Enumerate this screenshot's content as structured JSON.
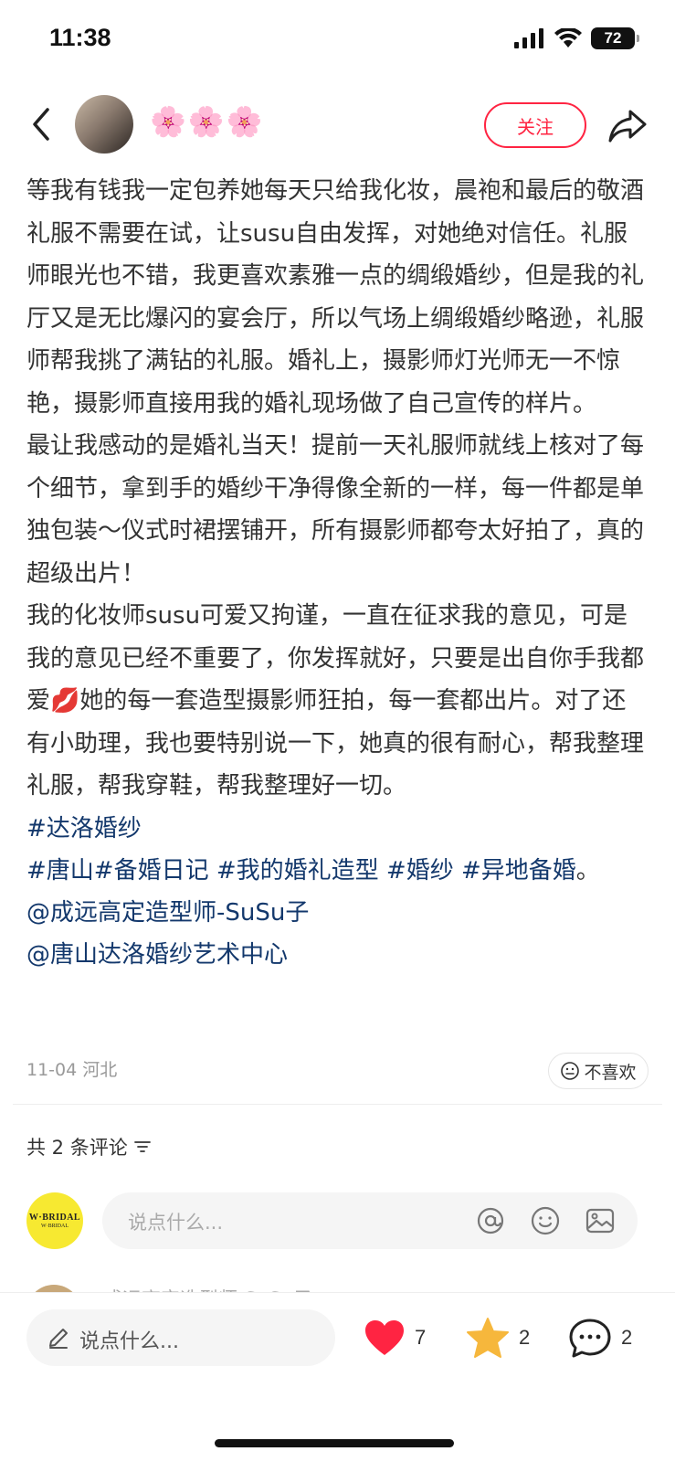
{
  "status_bar": {
    "time": "11:38",
    "battery": "72"
  },
  "nav": {
    "author_name": "🌸🌸🌸",
    "follow_label": "关注"
  },
  "post": {
    "paragraphs": [
      "等我有钱我一定包养她每天只给我化妆，晨袍和最后的敬酒礼服不需要在试，让susu自由发挥，对她绝对信任。礼服师眼光也不错，我更喜欢素雅一点的绸缎婚纱，但是我的礼厅又是无比爆闪的宴会厅，所以气场上绸缎婚纱略逊，礼服师帮我挑了满钻的礼服。婚礼上，摄影师灯光师无一不惊艳，摄影师直接用我的婚礼现场做了自己宣传的样片。",
      "最让我感动的是婚礼当天！提前一天礼服师就线上核对了每个细节，拿到手的婚纱干净得像全新的一样，每一件都是单独包装～仪式时裙摆铺开，所有摄影师都夸太好拍了，真的超级出片！",
      "我的化妆师susu可爱又拘谨，一直在征求我的意见，可是我的意见已经不重要了，你发挥就好，只要是出自你手我都爱💋她的每一套造型摄影师狂拍，每一套都出片。对了还有小助理，我也要特别说一下，她真的很有耐心，帮我整理礼服，帮我穿鞋，帮我整理好一切。"
    ],
    "tag_line1": [
      "#达洛婚纱"
    ],
    "tag_line2": [
      "#唐山",
      "#备婚日记",
      "#我的婚礼造型",
      "#婚纱",
      "#异地备婚"
    ],
    "tag_line2_suffix": "。",
    "mentions": [
      "@成远高定造型师-SuSu子",
      "@唐山达洛婚纱艺术中心"
    ],
    "date_location": "11-04 河北",
    "dislike_label": "不喜欢"
  },
  "comments": {
    "header": "共 2 条评论",
    "input_placeholder": "说点什么...",
    "my_avatar_text": "W·BRIDAL",
    "my_avatar_subtext": "W·BRIDAL",
    "partial_comment_name": "成远高定造型师-SuSu子"
  },
  "bottom_bar": {
    "input_placeholder": "说点什么...",
    "like_count": "7",
    "collect_count": "2",
    "comment_count": "2"
  },
  "colors": {
    "accent": "#ff2442",
    "link": "#13386c",
    "star": "#f6b73c"
  }
}
